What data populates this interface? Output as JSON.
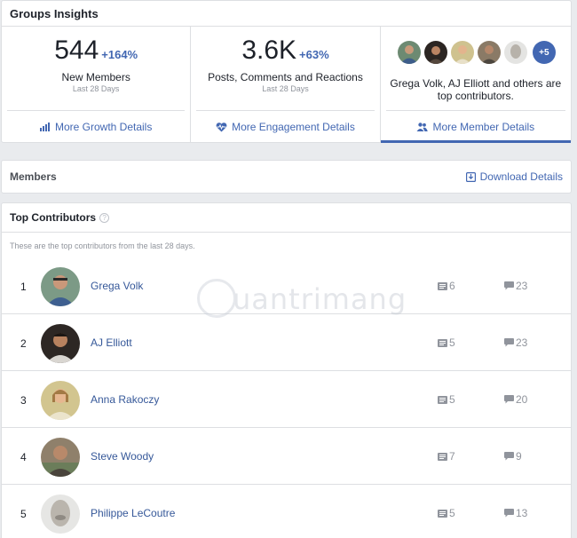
{
  "insights": {
    "title": "Groups Insights",
    "new_members": {
      "value": "544",
      "change": "+164%",
      "label": "New Members",
      "period": "Last 28 Days",
      "link": "More Growth Details"
    },
    "engagement": {
      "value": "3.6K",
      "change": "+63%",
      "label": "Posts, Comments and Reactions",
      "period": "Last 28 Days",
      "link": "More Engagement Details"
    },
    "member_details": {
      "extra_count": "+5",
      "text": "Grega Volk, AJ Elliott and others are top contributors.",
      "link": "More Member Details"
    }
  },
  "members_section": {
    "title": "Members",
    "download_label": "Download Details"
  },
  "top_contributors": {
    "title": "Top Contributors",
    "help_glyph": "?",
    "description": "These are the top contributors from the last 28 days.",
    "rows": [
      {
        "rank": "1",
        "name": "Grega Volk",
        "posts": "6",
        "comments": "23"
      },
      {
        "rank": "2",
        "name": "AJ Elliott",
        "posts": "5",
        "comments": "23"
      },
      {
        "rank": "3",
        "name": "Anna Rakoczy",
        "posts": "5",
        "comments": "20"
      },
      {
        "rank": "4",
        "name": "Steve Woody",
        "posts": "7",
        "comments": "9"
      },
      {
        "rank": "5",
        "name": "Philippe LeCoutre",
        "posts": "5",
        "comments": "13"
      }
    ]
  },
  "watermark": {
    "text": "uantrimang"
  },
  "colors": {
    "accent": "#4267b2",
    "link": "#365899",
    "muted": "#90949c",
    "background": "#e9ebee"
  },
  "icons": {
    "growth": "bar-chart-icon",
    "engagement": "heart-pulse-icon",
    "members": "people-icon",
    "download": "download-icon",
    "posts": "post-icon",
    "comments": "comment-icon"
  }
}
